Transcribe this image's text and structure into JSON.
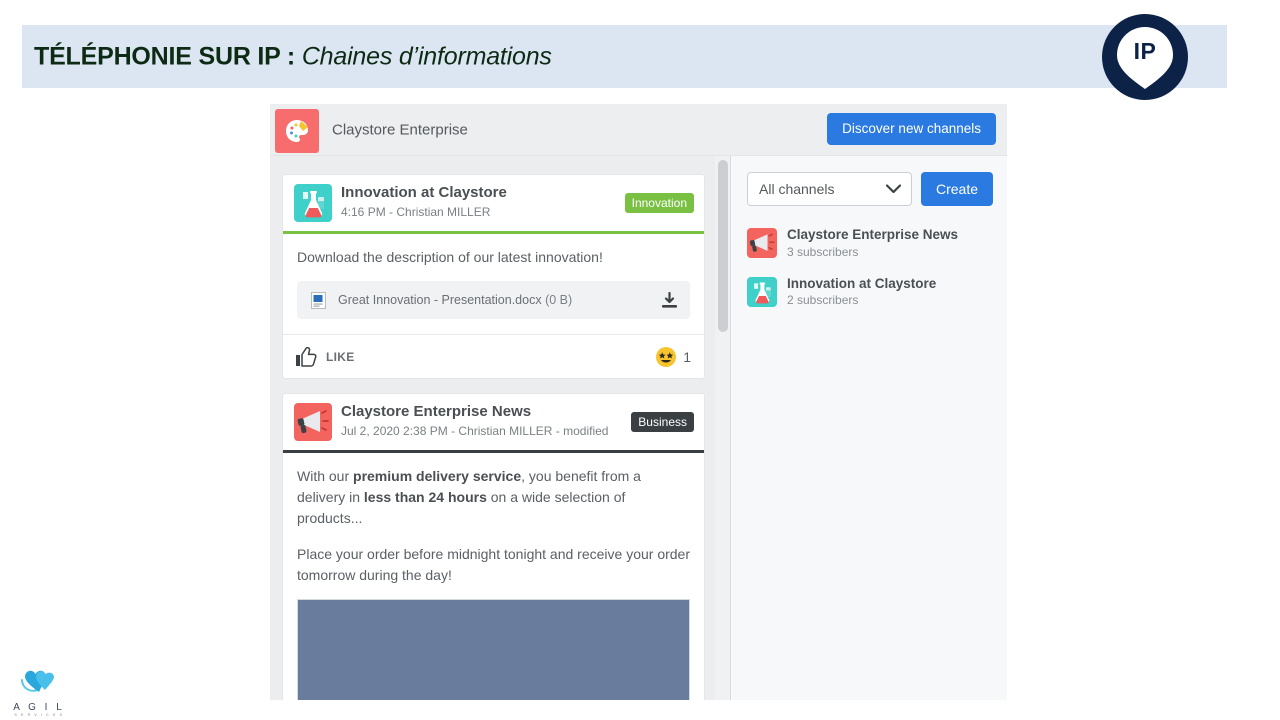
{
  "slide": {
    "title_bold": "TÉLÉPHONIE SUR IP :",
    "title_italic": "Chaines d’informations",
    "band_color": "#dce6f2",
    "title_color": "#0d2b14"
  },
  "ip_logo": {
    "label": "IP",
    "circle_color": "#0d2247",
    "pin_color": "#ffffff"
  },
  "app": {
    "logo_icon": "palette-icon",
    "name": "Claystore Enterprise",
    "discover_button": "Discover new channels",
    "accent_color": "#2a7ae2"
  },
  "feed": {
    "posts": [
      {
        "avatar_icon": "lab-flask-icon",
        "avatar_color": "#3fd0c9",
        "title": "Innovation at Claystore",
        "subtitle": "4:16 PM - Christian MILLER",
        "badge": "Innovation",
        "badge_color": "#7ac143",
        "accent_color": "#7ac143",
        "body": "Download the description of our latest innovation!",
        "attachment": {
          "file_icon": "docx-file-icon",
          "name": "Great Innovation - Presentation.docx",
          "size": "(0 B)",
          "download_icon": "download-icon"
        },
        "like_icon": "thumbs-up-icon",
        "like_label": "LIKE",
        "reaction_icon": "star-struck-emoji",
        "reaction_count": "1"
      },
      {
        "avatar_icon": "megaphone-icon",
        "avatar_color": "#f4645f",
        "title": "Claystore Enterprise News",
        "subtitle": "Jul 2, 2020 2:38 PM - Christian MILLER - modified",
        "badge": "Business",
        "badge_color": "#3a3f44",
        "accent_color": "#3a3f44",
        "paragraph1_a": "With our ",
        "paragraph1_b": "premium delivery service",
        "paragraph1_c": ", you benefit from a delivery in ",
        "paragraph1_d": "less than 24 hours",
        "paragraph1_e": " on a wide selection of products...",
        "paragraph2": "Place your order before midnight tonight and receive your order tomorrow during the day!",
        "image_color": "#697c9e"
      }
    ]
  },
  "sidebar": {
    "filter_value": "All channels",
    "filter_icon": "chevron-down-icon",
    "create_button": "Create",
    "channels": [
      {
        "avatar_icon": "megaphone-icon",
        "avatar_color": "#f4645f",
        "name": "Claystore Enterprise News",
        "subscribers": "3 subscribers"
      },
      {
        "avatar_icon": "lab-flask-icon",
        "avatar_color": "#3fd0c9",
        "name": "Innovation at Claystore",
        "subscribers": "2 subscribers"
      }
    ]
  },
  "agil_logo": {
    "name": "A G I L",
    "tagline": "S E R V I C E S"
  }
}
